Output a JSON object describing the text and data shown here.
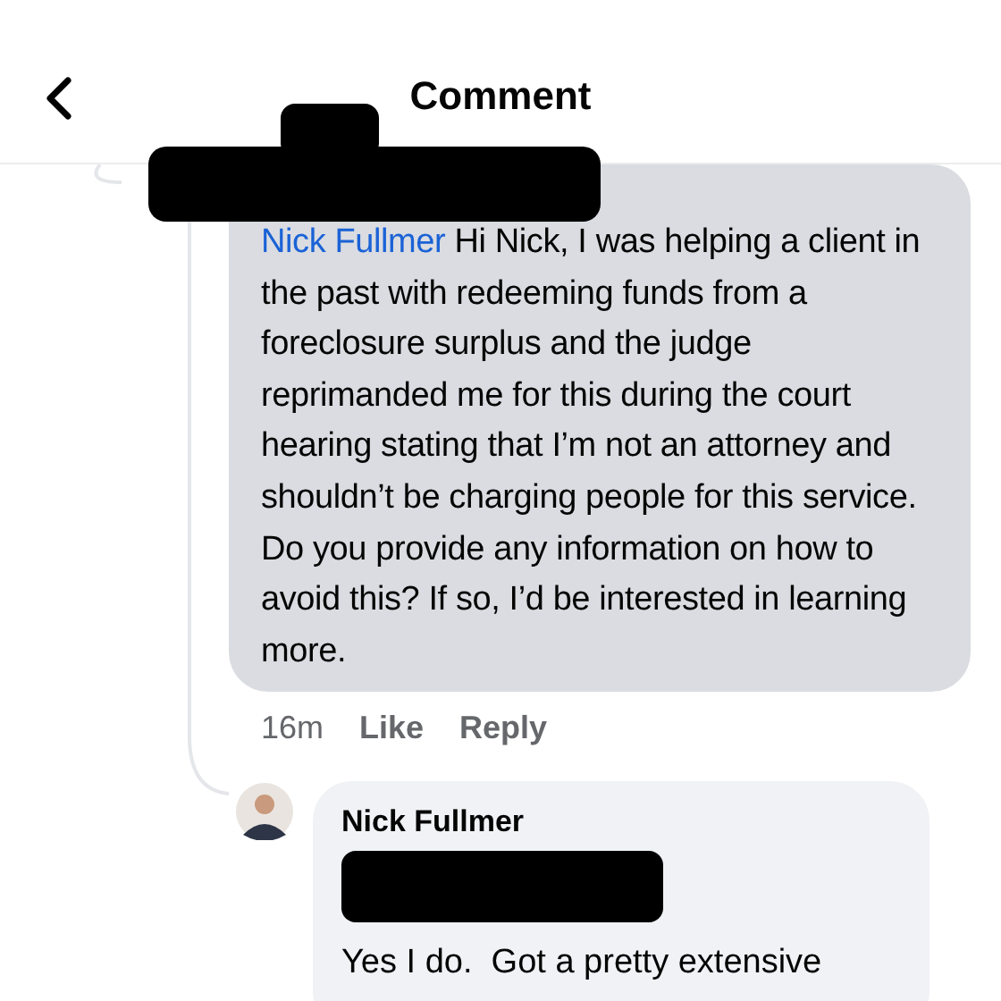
{
  "header": {
    "title": "Comment"
  },
  "comment": {
    "mention": "Nick Fullmer",
    "text": "Hi Nick, I was helping a client in the past with redeeming funds from a foreclosure surplus and the judge reprimanded me for this during the court hearing stating that I’m not an attorney and shouldn’t be charging people for this service. Do you provide any information on how to avoid this? If so, I’d be interested in learning more.",
    "time": "16m",
    "actions": [
      "Like",
      "Reply"
    ]
  },
  "reply": {
    "author": "Nick Fullmer",
    "text": "Yes I do.  Got a pretty extensive"
  }
}
